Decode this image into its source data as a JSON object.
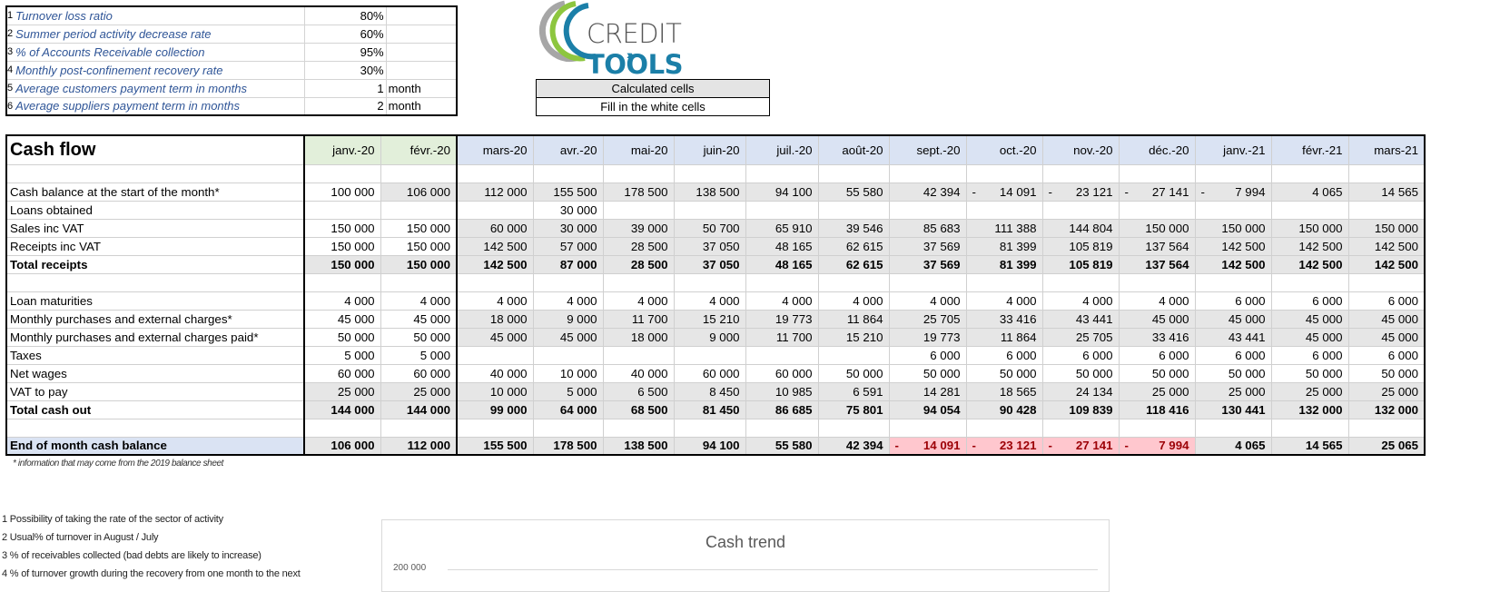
{
  "params": [
    {
      "n": "1",
      "label": "Turnover loss ratio",
      "value": "80%",
      "unit": ""
    },
    {
      "n": "2",
      "label": "Summer period activity decrease rate",
      "value": "60%",
      "unit": ""
    },
    {
      "n": "3",
      "label": "% of Accounts Receivable collection",
      "value": "95%",
      "unit": ""
    },
    {
      "n": "4",
      "label": "Monthly post-confinement recovery rate",
      "value": "30%",
      "unit": ""
    },
    {
      "n": "5",
      "label": "Average customers payment term in months",
      "value": "1",
      "unit": "month"
    },
    {
      "n": "6",
      "label": "Average suppliers payment term in months",
      "value": "2",
      "unit": "month"
    }
  ],
  "logo": {
    "credit": "CREDIT ",
    "tools": "TOOLS",
    "arrows": "›››"
  },
  "legend": {
    "calculated": "Calculated cells",
    "fill": "Fill in the white cells"
  },
  "cashflow": {
    "title": "Cash flow",
    "months": [
      "janv.-20",
      "févr.-20",
      "mars-20",
      "avr.-20",
      "mai-20",
      "juin-20",
      "juil.-20",
      "août-20",
      "sept.-20",
      "oct.-20",
      "nov.-20",
      "déc.-20",
      "janv.-21",
      "févr.-21",
      "mars-21"
    ],
    "rows": [
      {
        "label": "",
        "cells": [
          "",
          "",
          "",
          "",
          "",
          "",
          "",
          "",
          "",
          "",
          "",
          "",
          "",
          "",
          ""
        ]
      },
      {
        "label": "Cash balance at the start of the month*",
        "cells": [
          "100 000",
          "106 000",
          "112 000",
          "155 500",
          "178 500",
          "138 500",
          "94 100",
          "55 580",
          "42 394",
          "-14 091",
          "-23 121",
          "-27 141",
          "-7 994",
          "4 065",
          "14 565"
        ]
      },
      {
        "label": "Loans obtained",
        "cells": [
          "",
          "",
          "",
          "30 000",
          "",
          "",
          "",
          "",
          "",
          "",
          "",
          "",
          "",
          "",
          ""
        ]
      },
      {
        "label": "Sales inc VAT",
        "cells": [
          "150 000",
          "150 000",
          "60 000",
          "30 000",
          "39 000",
          "50 700",
          "65 910",
          "39 546",
          "85 683",
          "111 388",
          "144 804",
          "150 000",
          "150 000",
          "150 000",
          "150 000"
        ]
      },
      {
        "label": "Receipts inc VAT",
        "cells": [
          "150 000",
          "150 000",
          "142 500",
          "57 000",
          "28 500",
          "37 050",
          "48 165",
          "62 615",
          "37 569",
          "81 399",
          "105 819",
          "137 564",
          "142 500",
          "142 500",
          "142 500"
        ]
      },
      {
        "label": "Total receipts",
        "cells": [
          "150 000",
          "150 000",
          "142 500",
          "87 000",
          "28 500",
          "37 050",
          "48 165",
          "62 615",
          "37 569",
          "81 399",
          "105 819",
          "137 564",
          "142 500",
          "142 500",
          "142 500"
        ]
      },
      {
        "label": "",
        "cells": [
          "",
          "",
          "",
          "",
          "",
          "",
          "",
          "",
          "",
          "",
          "",
          "",
          "",
          "",
          ""
        ]
      },
      {
        "label": "Loan maturities",
        "cells": [
          "4 000",
          "4 000",
          "4 000",
          "4 000",
          "4 000",
          "4 000",
          "4 000",
          "4 000",
          "4 000",
          "4 000",
          "4 000",
          "4 000",
          "6 000",
          "6 000",
          "6 000"
        ]
      },
      {
        "label": "Monthly purchases and external charges*",
        "cells": [
          "45 000",
          "45 000",
          "18 000",
          "9 000",
          "11 700",
          "15 210",
          "19 773",
          "11 864",
          "25 705",
          "33 416",
          "43 441",
          "45 000",
          "45 000",
          "45 000",
          "45 000"
        ]
      },
      {
        "label": "Monthly purchases and external charges paid*",
        "cells": [
          "50 000",
          "50 000",
          "45 000",
          "45 000",
          "18 000",
          "9 000",
          "11 700",
          "15 210",
          "19 773",
          "11 864",
          "25 705",
          "33 416",
          "43 441",
          "45 000",
          "45 000"
        ]
      },
      {
        "label": "Taxes",
        "cells": [
          "5 000",
          "5 000",
          "",
          "",
          "",
          "",
          "",
          "",
          "6 000",
          "6 000",
          "6 000",
          "6 000",
          "6 000",
          "6 000",
          "6 000"
        ]
      },
      {
        "label": "Net wages",
        "cells": [
          "60 000",
          "60 000",
          "40 000",
          "10 000",
          "40 000",
          "60 000",
          "60 000",
          "50 000",
          "50 000",
          "50 000",
          "50 000",
          "50 000",
          "50 000",
          "50 000",
          "50 000"
        ]
      },
      {
        "label": "VAT to pay",
        "cells": [
          "25 000",
          "25 000",
          "10 000",
          "5 000",
          "6 500",
          "8 450",
          "10 985",
          "6 591",
          "14 281",
          "18 565",
          "24 134",
          "25 000",
          "25 000",
          "25 000",
          "25 000"
        ]
      },
      {
        "label": "Total cash out",
        "cells": [
          "144 000",
          "144 000",
          "99 000",
          "64 000",
          "68 500",
          "81 450",
          "86 685",
          "75 801",
          "94 054",
          "90 428",
          "109 839",
          "118 416",
          "130 441",
          "132 000",
          "132 000"
        ]
      },
      {
        "label": "",
        "cells": [
          "",
          "",
          "",
          "",
          "",
          "",
          "",
          "",
          "",
          "",
          "",
          "",
          "",
          "",
          ""
        ]
      },
      {
        "label": "End of month cash balance",
        "cells": [
          "106 000",
          "112 000",
          "155 500",
          "178 500",
          "138 500",
          "94 100",
          "55 580",
          "42 394",
          "-14 091",
          "-23 121",
          "-27 141",
          "-7 994",
          "4 065",
          "14 565",
          "25 065"
        ]
      }
    ]
  },
  "footnote": "* information that may come from the 2019 balance sheet",
  "notes": [
    "1 Possibility of taking the rate of the sector of activity",
    "2 Usual% of turnover in August / July",
    "3 % of receivables collected (bad debts are likely to increase)",
    "4 % of turnover growth during the recovery from one month to the next"
  ],
  "chart": {
    "title": "Cash trend",
    "ytick_top": "200 000"
  },
  "colors": {
    "accent_blue": "#2f5597",
    "negative_fill": "#ffc7ce",
    "negative_text": "#9c0006",
    "header_green": "#e2efda",
    "header_blue": "#dae3f3",
    "calculated_grey": "#e6e6e6"
  }
}
